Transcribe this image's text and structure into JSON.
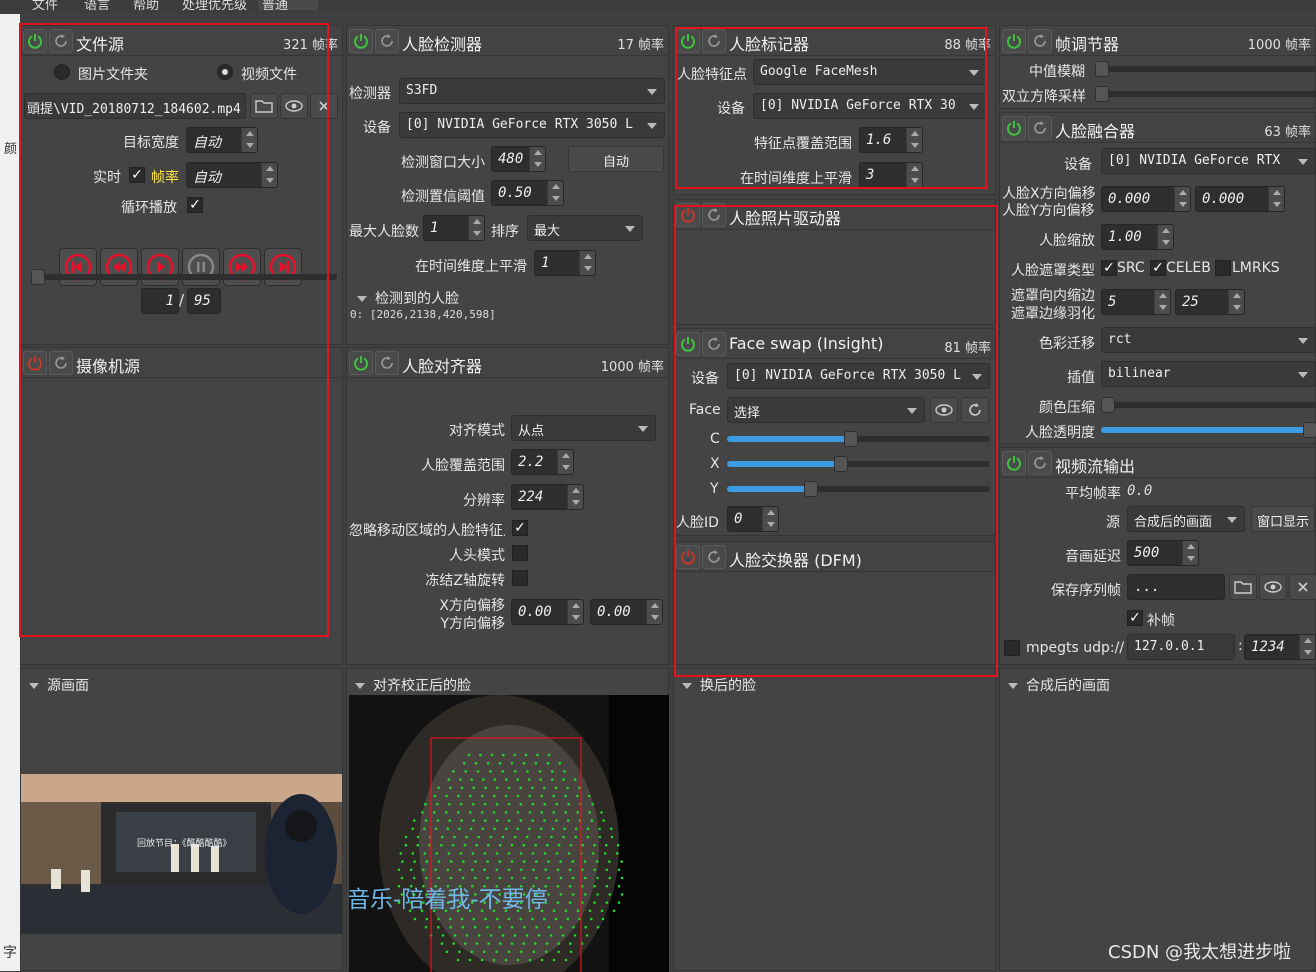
{
  "menu": {
    "file": "文件",
    "language": "语言",
    "help": "帮助",
    "process_priority": "处理优先级",
    "priority_value": "普通"
  },
  "file_source": {
    "title": "文件源",
    "fps": "321 帧率",
    "radio_image_folder": "图片文件夹",
    "radio_video_file": "视频文件",
    "path": "頭提\\VID_20180712_184602.mp4",
    "target_width_label": "目标宽度",
    "target_width_value": "自动",
    "realtime_label": "实时",
    "fps_label": "帧率",
    "fps_value": "自动",
    "loop_label": "循环播放",
    "frame_current": "1",
    "frame_sep": "/",
    "frame_total": "95"
  },
  "camera_source": {
    "title": "摄像机源"
  },
  "face_detector": {
    "title": "人脸检测器",
    "fps": "17 帧率",
    "detector_label": "检测器",
    "detector_value": "S3FD",
    "device_label": "设备",
    "device_value": "[0] NVIDIA GeForce RTX 3050 L",
    "window_label": "检测窗口大小",
    "window_value": "480",
    "window_auto": "自动",
    "threshold_label": "检测置信阈值",
    "threshold_value": "0.50",
    "max_faces_label": "最大人脸数",
    "max_faces_value": "1",
    "sort_label": "排序",
    "sort_value": "最大",
    "smooth_label": "在时间维度上平滑",
    "smooth_value": "1",
    "detected_label": "检测到的人脸",
    "detected_value": "0: [2026,2138,420,598]"
  },
  "face_aligner": {
    "title": "人脸对齐器",
    "fps": "1000 帧率",
    "mode_label": "对齐模式",
    "mode_value": "从点",
    "coverage_label": "人脸覆盖范围",
    "coverage_value": "2.2",
    "resolution_label": "分辨率",
    "resolution_value": "224",
    "ignore_label": "忽略移动区域的人脸特征点",
    "head_mode_label": "人头模式",
    "freeze_label": "冻结Z轴旋转",
    "x_offset_label": "X方向偏移",
    "y_offset_label": "Y方向偏移",
    "x_offset_value": "0.00",
    "y_offset_value": "0.00"
  },
  "face_marker": {
    "title": "人脸标记器",
    "fps": "88 帧率",
    "landmarks_label": "人脸特征点",
    "landmarks_value": "Google FaceMesh",
    "device_label": "设备",
    "device_value": "[0] NVIDIA GeForce RTX 30",
    "coverage_label": "特征点覆盖范围",
    "coverage_value": "1.6",
    "smooth_label": "在时间维度上平滑",
    "smooth_value": "3"
  },
  "face_animator": {
    "title": "人脸照片驱动器"
  },
  "face_swap_insight": {
    "title": "Face swap (Insight)",
    "fps": "81 帧率",
    "device_label": "设备",
    "device_value": "[0] NVIDIA GeForce RTX 3050 L",
    "face_label": "Face",
    "face_value": "选择",
    "c_label": "C",
    "x_label": "X",
    "y_label": "Y",
    "c_level": 0.47,
    "x_level": 0.43,
    "y_level": 0.31,
    "face_id_label": "人脸ID",
    "face_id_value": "0"
  },
  "face_swapper_dfm": {
    "title": "人脸交换器 (DFM)"
  },
  "frame_adjuster": {
    "title": "帧调节器",
    "fps": "1000 帧率",
    "median_label": "中值模糊",
    "bilateral_label": "双立方降采样"
  },
  "face_merger": {
    "title": "人脸融合器",
    "fps": "63 帧率",
    "device_label": "设备",
    "device_value": "[0] NVIDIA GeForce RTX",
    "x_offset_label": "人脸X方向偏移",
    "y_offset_label": "人脸Y方向偏移",
    "x_offset_value": "0.000",
    "y_offset_value": "0.000",
    "scale_label": "人脸缩放",
    "scale_value": "1.00",
    "mask_type_label": "人脸遮罩类型",
    "mask_src": "SRC",
    "mask_celeb": "CELEB",
    "mask_lmrks": "LMRKS",
    "erode_label": "遮罩向内缩边",
    "blur_label": "遮罩边缘羽化",
    "erode_value": "5",
    "blur_value": "25",
    "color_transfer_label": "色彩迁移",
    "color_transfer_value": "rct",
    "interp_label": "插值",
    "interp_value": "bilinear",
    "color_compress_label": "颜色压缩",
    "opacity_label": "人脸透明度",
    "opacity_level": 1.0
  },
  "stream_output": {
    "title": "视频流输出",
    "avg_fps_label": "平均帧率",
    "avg_fps_value": "0.0",
    "source_label": "源",
    "source_value": "合成后的画面",
    "window_btn": "窗口显示",
    "delay_label": "音画延迟",
    "delay_value": "500",
    "save_label": "保存序列帧",
    "save_value": "...",
    "fill_label": "补帧",
    "mpegts_label": "mpegts udp://",
    "host_value": "127.0.0.1",
    "port_sep": ":",
    "port_value": "1234"
  },
  "viewers": {
    "source": "源画面",
    "aligned": "对齐校正后的脸",
    "swapped": "换后的脸",
    "merged": "合成后的画面"
  },
  "overlay": {
    "stage_text": "回放节目：《酷酷酷酷》",
    "lyric": "酷我音乐-陪着我-不要停",
    "watermark": "CSDN @我太想进步啦"
  },
  "left_strip": {
    "char1": "颜",
    "char2": "字"
  },
  "colors": {
    "accent": "#3d9be3",
    "power_on": "#3ec13e",
    "power_off": "#c0392b",
    "media_red": "#e8102a",
    "highlight_box": "#e0141e",
    "fps_yellow": "#ffe642"
  }
}
